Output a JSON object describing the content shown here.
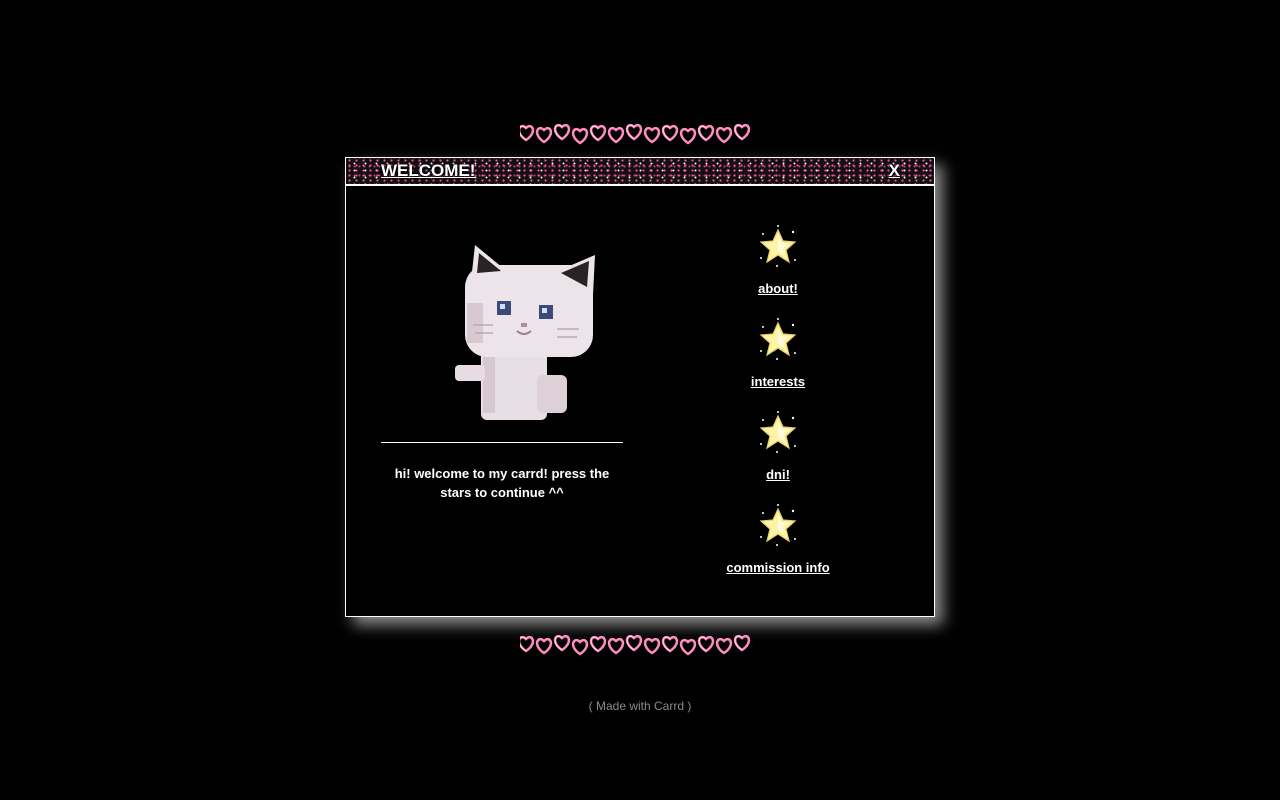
{
  "window": {
    "title": "WELCOME!",
    "close_label": "X"
  },
  "intro": {
    "text": "hi! welcome to my carrd! press the stars to continue ^^"
  },
  "menu": {
    "items": [
      {
        "label": "about!",
        "icon": "star-icon"
      },
      {
        "label": "interests",
        "icon": "star-icon"
      },
      {
        "label": "dni!",
        "icon": "star-icon"
      },
      {
        "label": "commission info",
        "icon": "star-icon"
      }
    ]
  },
  "footer": {
    "text": "( Made with Carrd )"
  },
  "colors": {
    "background": "#000000",
    "text": "#ffffff",
    "accent_pink": "#ff7fb8",
    "star_yellow": "#fff3a6"
  }
}
